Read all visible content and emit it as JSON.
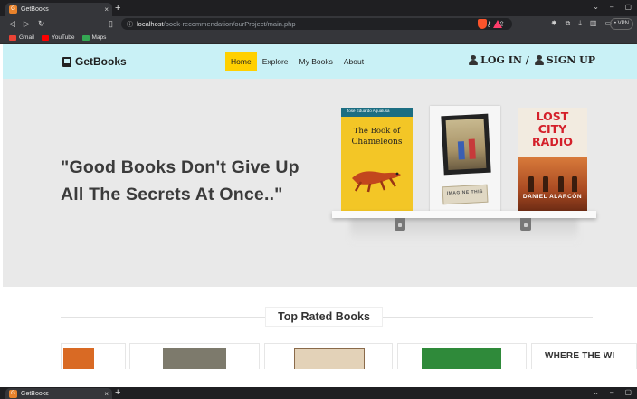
{
  "browser": {
    "tab_title": "GetBooks",
    "favicon_label": "G",
    "tab_close": "×",
    "new_tab": "+",
    "window_controls": [
      "⌄",
      "–",
      "▢"
    ],
    "nav": [
      "◁",
      "▷",
      "↻"
    ],
    "bookmark_icon": "▯",
    "url_host": "localhost",
    "url_path": "/book-recommendation/ourProject/main.php",
    "url_icon": "ⓘ",
    "url_right_icons": [
      "⚷",
      "⇪"
    ],
    "toolbar_icons": [
      "✸",
      "⧉",
      "⤓",
      "▥",
      "▭"
    ],
    "vpn_label": "• VPN",
    "bookmarks": [
      {
        "label": "Gmail",
        "color": "#ea4335"
      },
      {
        "label": "YouTube",
        "color": "#ff0000"
      },
      {
        "label": "Maps",
        "color": "#34a853"
      }
    ]
  },
  "site": {
    "logo": "GetBooks",
    "menu": [
      {
        "label": "Home",
        "active": true
      },
      {
        "label": "Explore",
        "active": false
      },
      {
        "label": "My Books",
        "active": false
      },
      {
        "label": "About",
        "active": false
      }
    ],
    "login": "LOG IN /",
    "signup": "SIGN UP",
    "hero": {
      "line1": "\"Good Books Don't Give Up",
      "line2": "All The Secrets At Once..\""
    },
    "books": [
      {
        "author": "José Eduardo Agualusa",
        "title_line1": "The Book of",
        "title_line2": "Chameleons"
      },
      {
        "plate_text": "IMAGINE THIS"
      },
      {
        "title_lines": [
          "LOST",
          "CITY",
          "RADIO"
        ],
        "author": "DANIEL ALARCÓN"
      }
    ],
    "top_rated_title": "Top Rated Books",
    "top_rated_thumb_text": "WHERE THE WI"
  },
  "colors": {
    "header_bg": "#c9f1f6",
    "active_menu": "#ffd000",
    "hero_bg": "#e9e9e9"
  }
}
